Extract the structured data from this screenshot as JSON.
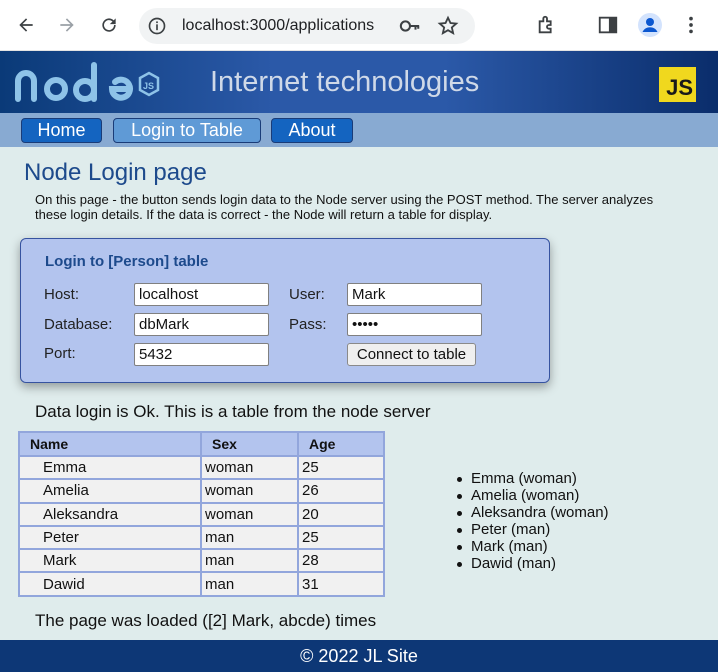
{
  "browser": {
    "url": "localhost:3000/applications"
  },
  "header": {
    "site_title": "Internet technologies",
    "js_badge": "JS"
  },
  "menu": {
    "home": "Home",
    "login": "Login to Table",
    "about": "About"
  },
  "main": {
    "title": "Node Login page",
    "description": "On this page - the button sends login data to the Node server using the POST method. The server analyzes these login details. If the data is correct - the Node will return a table for display."
  },
  "login_form": {
    "title": "Login to [Person] table",
    "host_label": "Host:",
    "host_value": "localhost",
    "database_label": "Database:",
    "database_value": "dbMark",
    "port_label": "Port:",
    "port_value": "5432",
    "user_label": "User:",
    "user_value": "Mark",
    "pass_label": "Pass:",
    "pass_value": "abcde",
    "connect_label": "Connect to table"
  },
  "result": {
    "ok_message": "Data login is Ok. This is a table from the node server",
    "loaded_message": "The page was loaded ([2] Mark, abcde) times"
  },
  "table": {
    "headers": [
      "Name",
      "Sex",
      "Age"
    ],
    "rows": [
      [
        "Emma",
        "woman",
        "25"
      ],
      [
        "Amelia",
        "woman",
        "26"
      ],
      [
        "Aleksandra",
        "woman",
        "20"
      ],
      [
        "Peter",
        "man",
        "25"
      ],
      [
        "Mark",
        "man",
        "28"
      ],
      [
        "Dawid",
        "man",
        "31"
      ]
    ]
  },
  "side_list": [
    "Emma (woman)",
    "Amelia (woman)",
    "Aleksandra (woman)",
    "Peter (man)",
    "Mark (man)",
    "Dawid (man)"
  ],
  "footer": {
    "text": "© 2022 JL Site"
  },
  "colors": {
    "banner": "#2b59a8",
    "menu_button": "#1464c0",
    "menu_button_active": "#5f9ad6",
    "card": "#b3c4ee",
    "page_background": "#dfecec",
    "footer": "#0d3776",
    "title_text": "#1d4a8c"
  },
  "icons": [
    "back-arrow-icon",
    "forward-arrow-icon",
    "reload-icon",
    "info-icon",
    "key-icon",
    "star-icon",
    "extensions-icon",
    "side-panel-icon",
    "profile-icon",
    "more-menu-icon",
    "node-js-logo",
    "js-logo"
  ]
}
